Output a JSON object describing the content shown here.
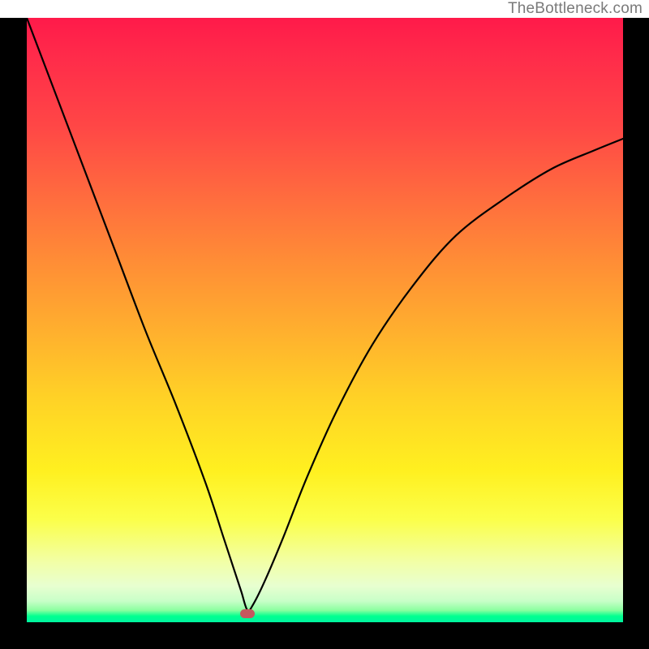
{
  "watermark": {
    "text": "TheBottleneck.com"
  },
  "colors": {
    "frame": "#000000",
    "curve": "#000000",
    "marker": "#c6585e",
    "gradient_top": "#ff1a4a",
    "gradient_bottom": "#00f5a0"
  },
  "chart_data": {
    "type": "line",
    "title": "",
    "xlabel": "",
    "ylabel": "",
    "xlim": [
      0,
      100
    ],
    "ylim": [
      0,
      100
    ],
    "grid": false,
    "legend": false,
    "annotations": [
      {
        "type": "marker",
        "x": 37,
        "y": 1.5,
        "label": "minimum"
      }
    ],
    "series": [
      {
        "name": "curve",
        "x": [
          0,
          5,
          10,
          15,
          20,
          25,
          30,
          33,
          35,
          36,
          37,
          38,
          40,
          43,
          47,
          52,
          58,
          65,
          72,
          80,
          88,
          95,
          100
        ],
        "values": [
          100,
          87,
          74,
          61,
          48,
          36,
          23,
          14,
          8,
          5,
          2,
          3,
          7,
          14,
          24,
          35,
          46,
          56,
          64,
          70,
          75,
          78,
          80
        ]
      }
    ]
  }
}
